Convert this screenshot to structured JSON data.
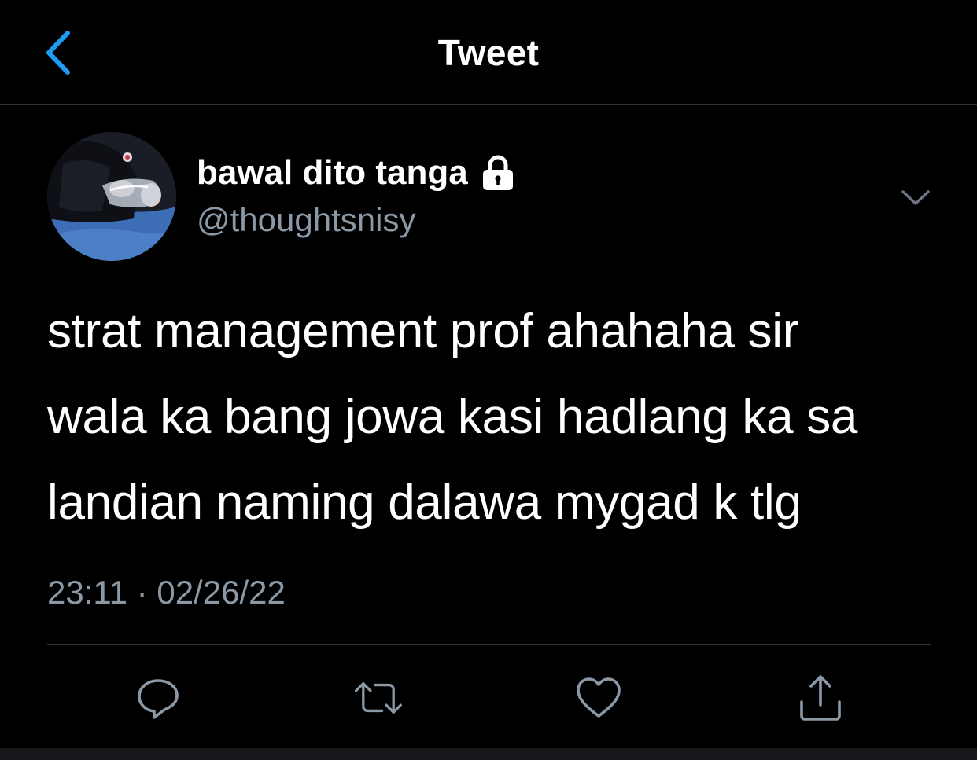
{
  "header": {
    "title": "Tweet",
    "back_icon": "chevron-left-icon"
  },
  "author": {
    "display_name": "bawal dito tanga",
    "handle": "@thoughtsnisy",
    "protected_icon": "lock-icon"
  },
  "tweet": {
    "lines": [
      "strat management prof ahahaha sir",
      "wala ka bang jowa kasi hadlang ka sa",
      "landian naming dalawa mygad k tlg"
    ],
    "time": "23:11",
    "separator": "·",
    "date": "02/26/22"
  },
  "actions": [
    {
      "name": "reply",
      "icon": "reply-icon"
    },
    {
      "name": "retweet",
      "icon": "retweet-icon"
    },
    {
      "name": "like",
      "icon": "heart-icon"
    },
    {
      "name": "share",
      "icon": "share-icon"
    }
  ],
  "colors": {
    "background": "#000000",
    "accent": "#1d9bf0",
    "primary_text": "#ffffff",
    "secondary_text": "#8b98a5",
    "divider": "#2f3336"
  }
}
